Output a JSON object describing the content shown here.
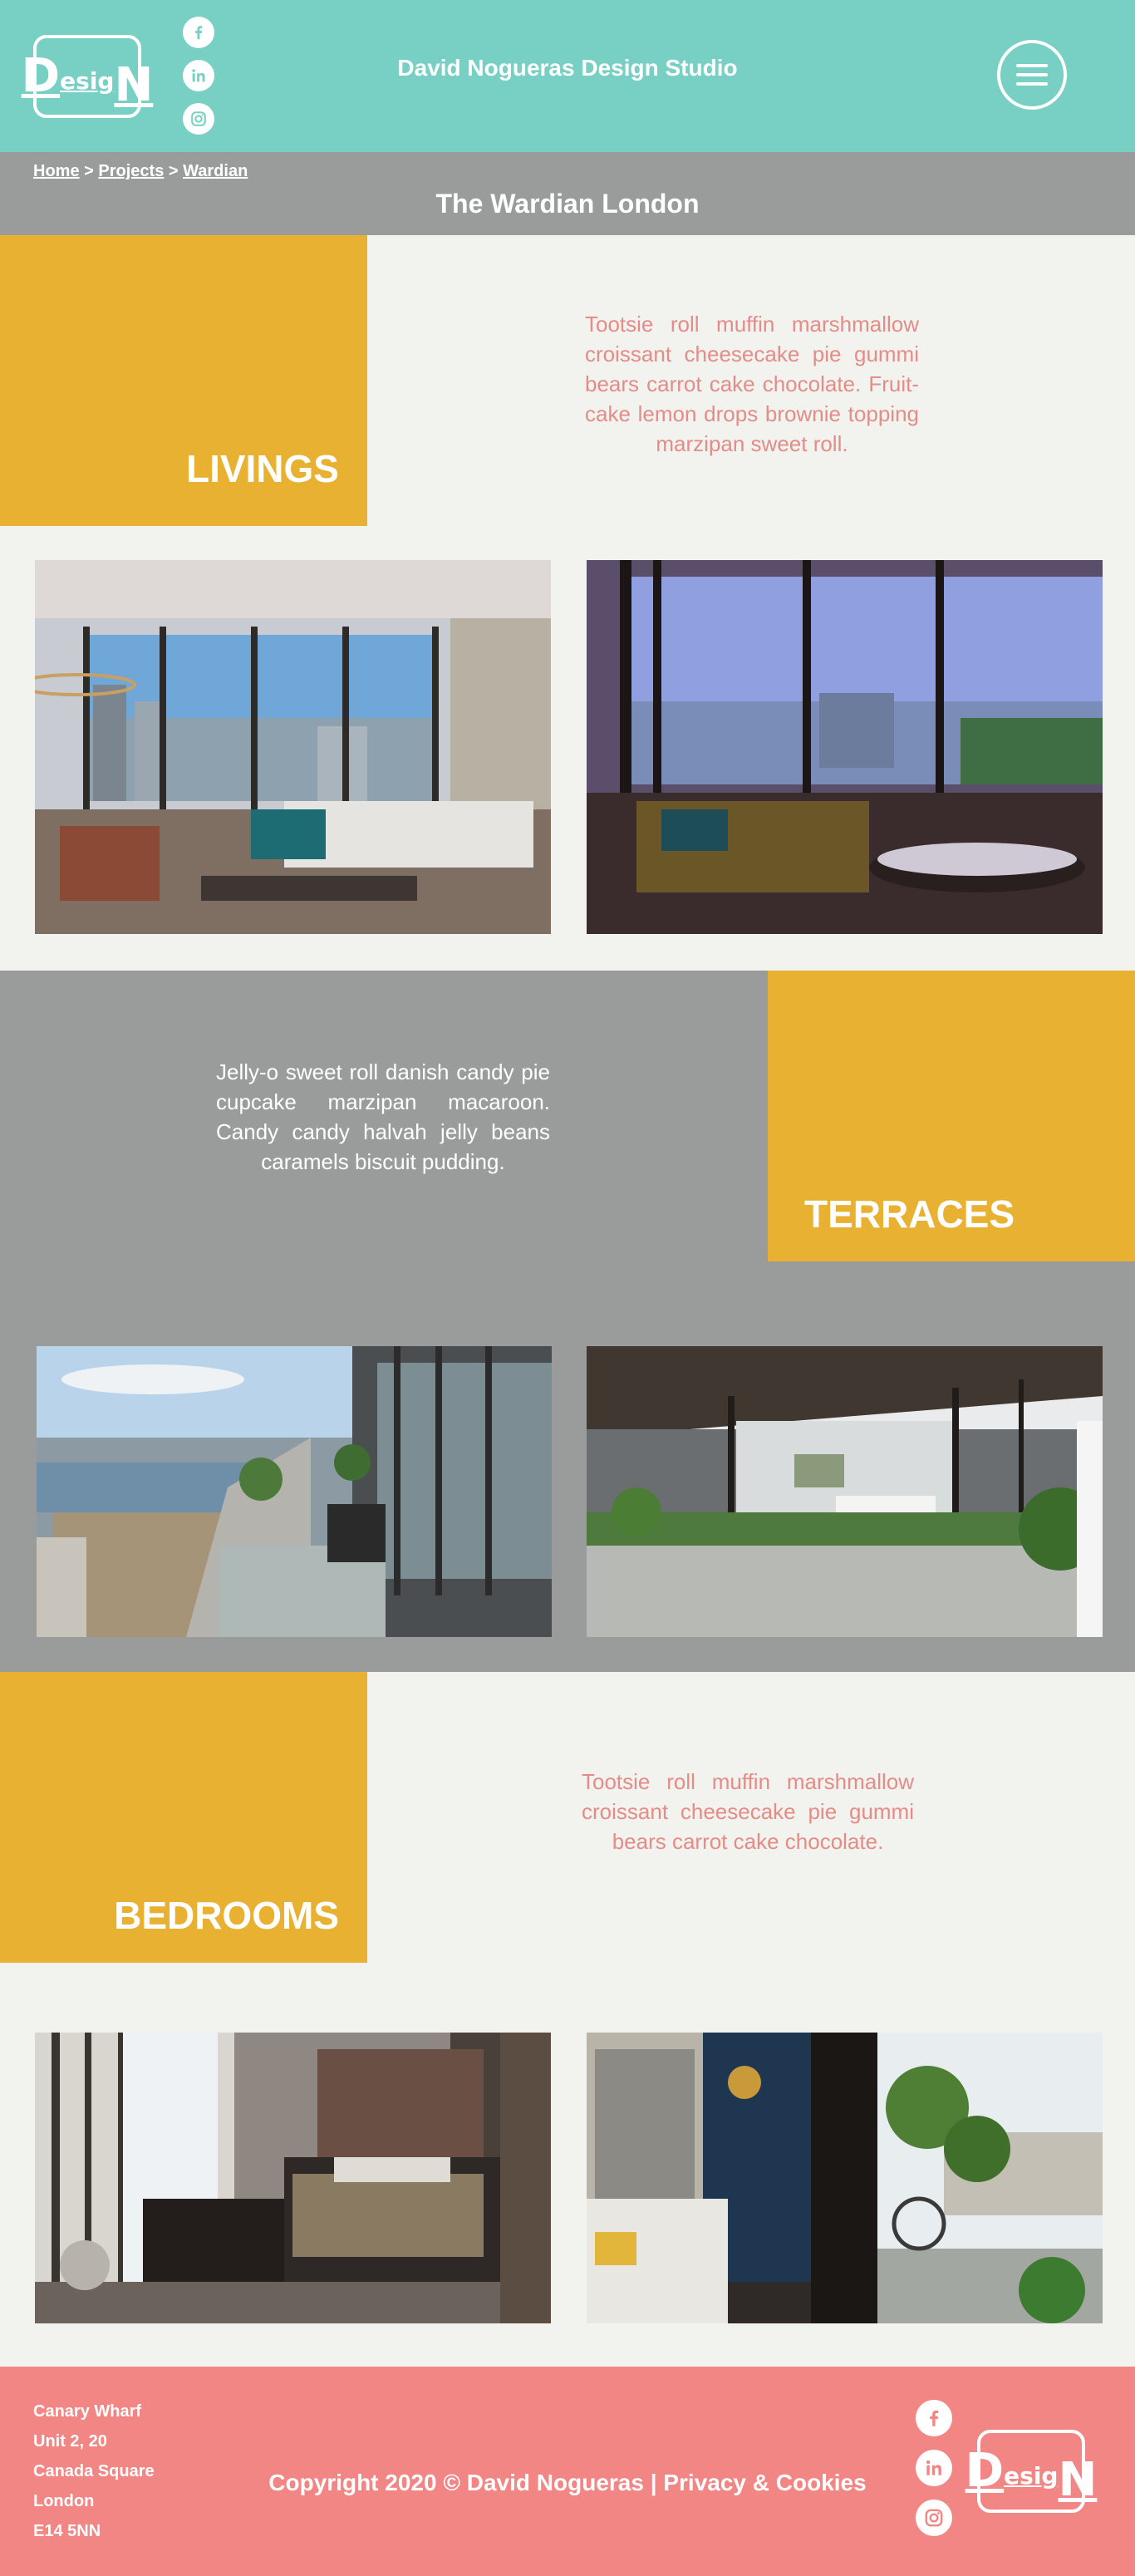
{
  "header": {
    "logo_text": {
      "d": "D",
      "esig": "esig",
      "n": "N"
    },
    "site_title": "David Nogueras Design Studio",
    "social_icons": [
      "facebook-icon",
      "linkedin-icon",
      "instagram-icon"
    ],
    "menu_icon": "hamburger-menu-icon"
  },
  "breadcrumb": {
    "items": [
      "Home",
      "Projects",
      "Wardian"
    ],
    "separator": ">"
  },
  "page_title": "The Wardian London",
  "sections": {
    "livings": {
      "title": "LIVINGS",
      "text": "Tootsie roll muffin marshmallow croissant cheesecake pie gummi bears carrot cake chocolate. Fruit-cake lemon drops brownie topping marzipan sweet roll.",
      "images": [
        "Living room with city view and teal armchairs",
        "Living room with sectional sofa and terrace view"
      ]
    },
    "terraces": {
      "title": "TERRACES",
      "text": "Jelly-o sweet roll danish candy pie cupcake marzipan macaroon. Candy candy halvah jelly beans caramels biscuit pudding.",
      "images": [
        "Terrace with glass balustrade overlooking docks",
        "Planted terrace outside glazed living room"
      ]
    },
    "bedrooms": {
      "title": "BEDROOMS",
      "text": "Tootsie roll muffin marshmallow croissant cheesecake pie gummi bears carrot cake chocolate.",
      "images": [
        "Bedroom with dark headboard and window",
        "Bedroom opening onto planted balcony"
      ]
    }
  },
  "footer": {
    "address": [
      "Canary Wharf",
      "Unit 2, 20",
      "Canada Square",
      "London",
      "E14 5NN"
    ],
    "copyright": "Copyright 2020 © David Nogueras",
    "separator": "|",
    "privacy_link": "Privacy & Cookies",
    "social_icons": [
      "facebook-icon",
      "linkedin-icon",
      "instagram-icon"
    ]
  },
  "colors": {
    "header_teal": "#78cfc4",
    "grey": "#9a9c9b",
    "gold": "#e8b132",
    "footer_pink": "#f28685",
    "text_pink": "#e48c88",
    "background": "#f2f2ee"
  }
}
